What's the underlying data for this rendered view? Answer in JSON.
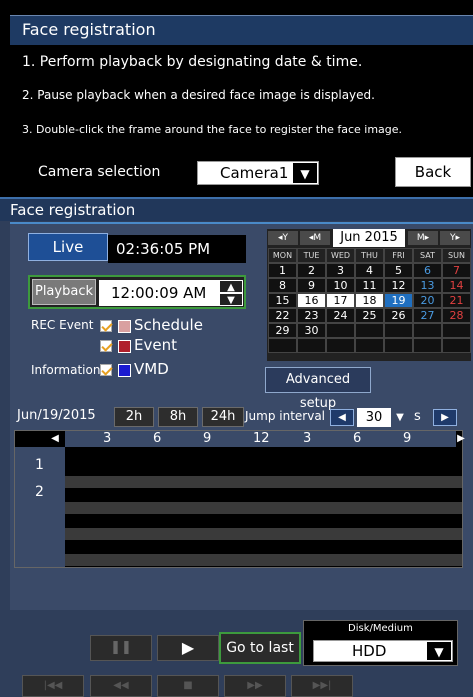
{
  "top": {
    "title": "Face registration"
  },
  "instructions": {
    "step1": "1. Perform playback by designating date & time.",
    "step2": "2. Pause playback when a desired face image is displayed.",
    "step3": "3. Double-click the frame around the face to register the face image."
  },
  "camera": {
    "label": "Camera selection",
    "value": "Camera1"
  },
  "back_label": "Back",
  "section": {
    "title": "Face registration"
  },
  "live": {
    "label": "Live",
    "time": "02:36:05 PM"
  },
  "playback": {
    "label": "Playback",
    "time": "12:00:09 AM"
  },
  "events": {
    "rec_label": "REC Event",
    "schedule_label": "Schedule",
    "event_label": "Event",
    "info_label": "Information",
    "vmd_label": "VMD",
    "schedule_color": "#d9a0a0",
    "event_color": "#b0202c",
    "vmd_color": "#1a1ad0"
  },
  "calendar": {
    "year_prev": "◂Y",
    "month_prev": "◂M",
    "month_label": "Jun 2015",
    "month_next": "M▸",
    "year_next": "Y▸",
    "days": [
      "MON",
      "TUE",
      "WED",
      "THU",
      "FRI",
      "SAT",
      "SUN"
    ],
    "weeks": [
      [
        "1",
        "2",
        "3",
        "4",
        "5",
        "6",
        "7"
      ],
      [
        "8",
        "9",
        "10",
        "11",
        "12",
        "13",
        "14"
      ],
      [
        "15",
        "16",
        "17",
        "18",
        "19",
        "20",
        "21"
      ],
      [
        "22",
        "23",
        "24",
        "25",
        "26",
        "27",
        "28"
      ],
      [
        "29",
        "30",
        "",
        "",
        "",
        "",
        ""
      ],
      [
        "",
        "",
        "",
        "",
        "",
        "",
        ""
      ]
    ],
    "selected": "19"
  },
  "advanced_setup": "Advanced setup",
  "timeline": {
    "date": "Jun/19/2015",
    "range_2h": "2h",
    "range_8h": "8h",
    "range_24h": "24h",
    "jump_label": "Jump interval",
    "jump_value": "30",
    "jump_unit": "s",
    "hours": [
      "3",
      "6",
      "9",
      "12",
      "3",
      "6",
      "9"
    ],
    "rows": [
      "1",
      "2"
    ]
  },
  "controls": {
    "go_to_last": "Go to last",
    "disk_label": "Disk/Medium",
    "disk_value": "HDD"
  }
}
